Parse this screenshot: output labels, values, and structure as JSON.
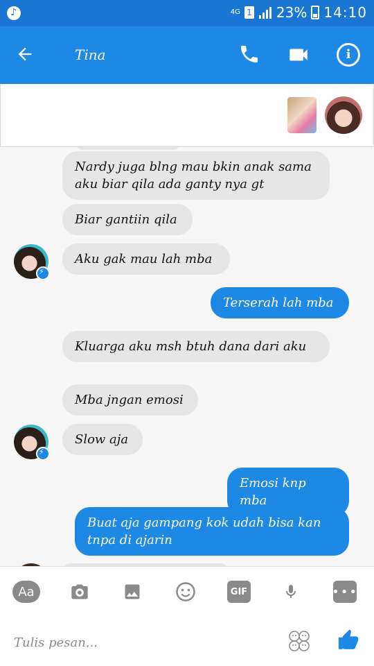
{
  "status_bar": {
    "network": "4G",
    "sim": "1",
    "battery": "23%",
    "time": "14:10",
    "icons": [
      "music-note-icon",
      "sim-icon",
      "signal-icon",
      "battery-icon"
    ]
  },
  "header": {
    "title": "Tina",
    "icons": [
      "back-arrow-icon",
      "phone-icon",
      "video-camera-icon",
      "info-icon"
    ]
  },
  "messages": [
    {
      "from": "contact",
      "text": "Nardy juga blng mau bkin anak sama aku biar qila ada ganty nya gt"
    },
    {
      "from": "contact",
      "text": "Biar gantiin qila"
    },
    {
      "from": "contact",
      "text": "Aku gak mau lah mba"
    },
    {
      "from": "me",
      "text": "Terserah lah mba"
    },
    {
      "from": "contact",
      "text": "Kluarga aku msh btuh dana dari aku"
    },
    {
      "from": "contact",
      "text": "Mba jngan emosi"
    },
    {
      "from": "contact",
      "text": "Slow aja"
    },
    {
      "from": "me",
      "text": "Emosi knp mba"
    },
    {
      "from": "me",
      "text": "Buat aja gampang kok udah bisa kan tnpa di ajarin"
    }
  ],
  "toolbar": {
    "aa_label": "Aa",
    "gif_label": "GIF",
    "more_label": "•••",
    "icons": [
      "text-format-icon",
      "camera-icon",
      "image-icon",
      "emoji-icon",
      "gif-icon",
      "microphone-icon",
      "more-icon"
    ]
  },
  "composer": {
    "placeholder": "Tulis pesan...",
    "icons": [
      "stickers-icon",
      "like-icon"
    ]
  },
  "colors": {
    "primary": "#1e88e5",
    "status_bar": "#1976d2",
    "incoming_bubble": "#e6e6e6",
    "outgoing_bubble": "#1e88e5",
    "background": "#f6f6f6"
  }
}
